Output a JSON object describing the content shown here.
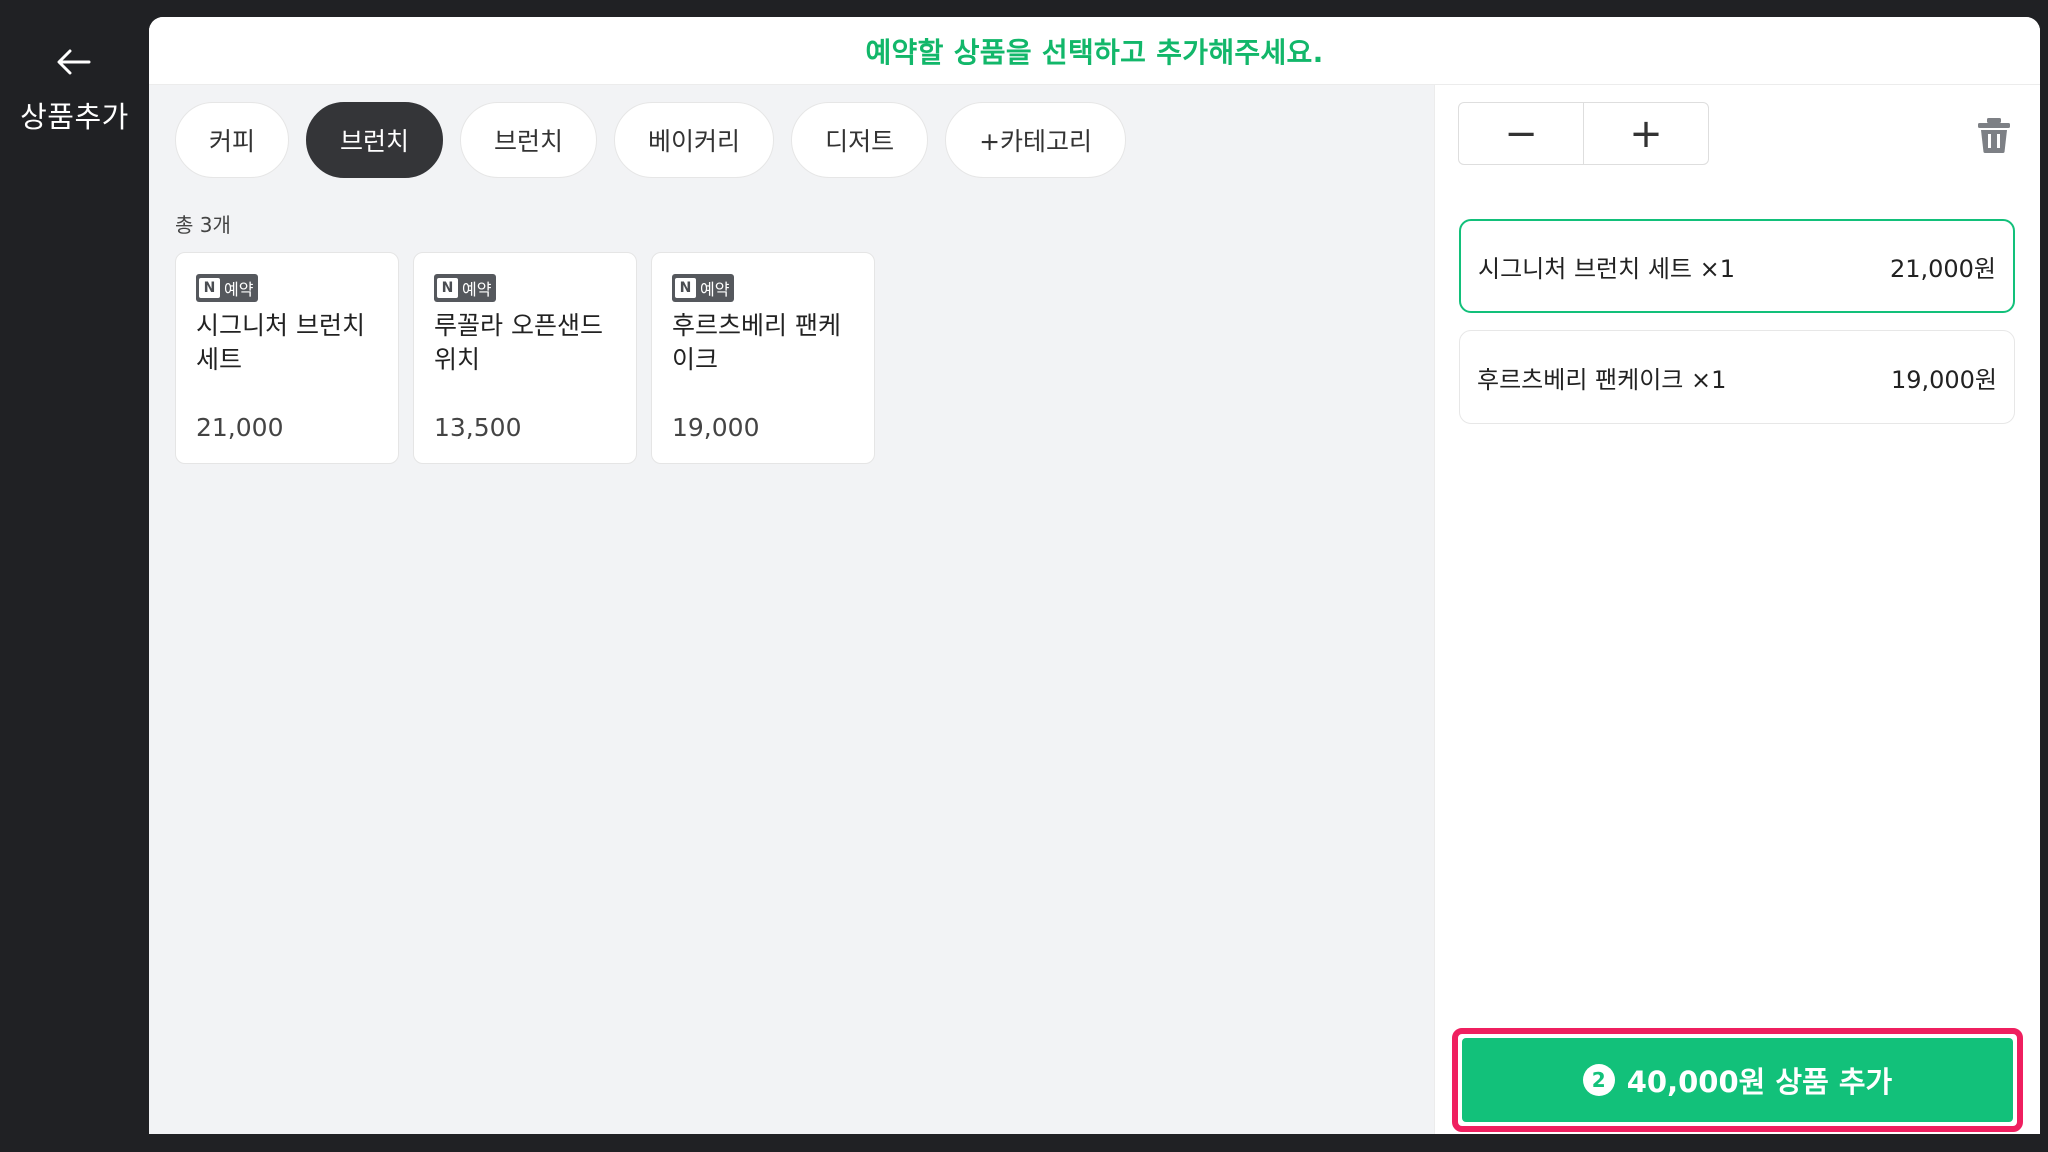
{
  "rail": {
    "back_icon": "arrow-left-icon",
    "title": "상품추가"
  },
  "header": {
    "message": "예약할 상품을 선택하고 추가해주세요."
  },
  "tabs": [
    {
      "label": "커피",
      "active": false
    },
    {
      "label": "브런치",
      "active": true
    },
    {
      "label": "브런치",
      "active": false
    },
    {
      "label": "베이커리",
      "active": false
    },
    {
      "label": "디저트",
      "active": false
    },
    {
      "label": "+카테고리",
      "active": false
    }
  ],
  "products": {
    "count_label": "총 3개",
    "badge": {
      "mark": "N",
      "text": "예약"
    },
    "items": [
      {
        "name": "시그니처 브런치 세트",
        "price": "21,000"
      },
      {
        "name": "루꼴라 오픈샌드위치",
        "price": "13,500"
      },
      {
        "name": "후르츠베리 팬케이크",
        "price": "19,000"
      }
    ]
  },
  "cart": {
    "decrement_label": "−",
    "increment_label": "+",
    "items": [
      {
        "name": "시그니처 브런치 세트 ×1",
        "price": "21,000원",
        "selected": true
      },
      {
        "name": "후르츠베리 팬케이크 ×1",
        "price": "19,000원",
        "selected": false
      }
    ],
    "add_button": {
      "count": "2",
      "label": "40,000원 상품 추가"
    }
  },
  "colors": {
    "accent": "#12c17a",
    "highlight": "#ef1f5f",
    "dark": "#202124"
  }
}
